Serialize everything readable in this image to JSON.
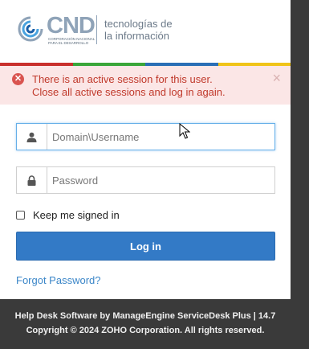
{
  "logo": {
    "brand": "CND",
    "subtitle": "CORPORACIÓN NACIONAL PARA EL DESARROLLO",
    "tagline_line1": "tecnologías de",
    "tagline_line2": "la información"
  },
  "stripes": [
    "#c9302c",
    "#3aa63a",
    "#2a6fb6",
    "#f0c419"
  ],
  "alert": {
    "line1": "There is an active session for this user.",
    "line2": "Close all active sessions and log in again.",
    "icon": "x-circle-icon",
    "close": "×"
  },
  "login": {
    "username_placeholder": "Domain\\Username",
    "password_placeholder": "Password",
    "remember_label": "Keep me signed in",
    "button_label": "Log in",
    "forgot_label": "Forgot Password?"
  },
  "footer": {
    "line1": "Help Desk Software by ManageEngine ServiceDesk Plus | 14.7",
    "line2": "Copyright © 2024 ZOHO Corporation. All rights reserved."
  }
}
